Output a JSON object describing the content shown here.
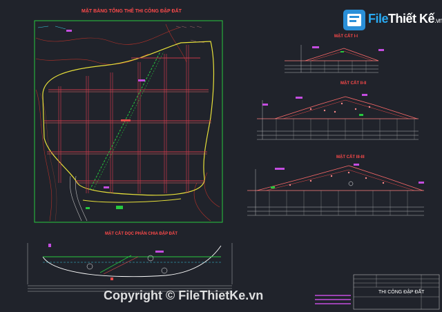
{
  "logo": {
    "file": "File",
    "rest": "Thiết Kế",
    "tld": ".vn"
  },
  "plan": {
    "title": "MẶT BẰNG TỔNG THỂ THI CÔNG ĐẬP ĐẤT"
  },
  "section1": {
    "title": "MẶT CẮT I-I"
  },
  "section2": {
    "title": "MẶT CẮT II-II"
  },
  "section3": {
    "title": "MẶT CẮT III-III"
  },
  "profile": {
    "title": "MẶT CẮT DỌC PHÂN CHIA ĐẬP ĐẤT"
  },
  "title_block": {
    "name": "THI CÔNG ĐẬP ĐẤT"
  },
  "watermark": "Copyright © FileThietKe.vn",
  "colors": {
    "background": "#20232b",
    "frame_green": "#27c93f",
    "contour_yellow": "#e9e23a",
    "title_red": "#ff4a4a",
    "accent_magenta": "#c44de0",
    "water_cyan": "#39d0e6"
  }
}
